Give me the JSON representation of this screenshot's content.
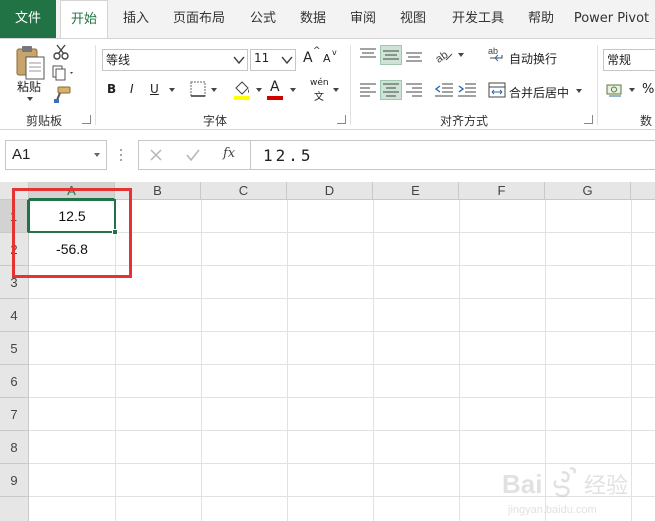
{
  "tabs": [
    {
      "id": "file",
      "label": "文件"
    },
    {
      "id": "home",
      "label": "开始"
    },
    {
      "id": "insert",
      "label": "插入"
    },
    {
      "id": "layout",
      "label": "页面布局"
    },
    {
      "id": "formula",
      "label": "公式"
    },
    {
      "id": "data",
      "label": "数据"
    },
    {
      "id": "review",
      "label": "审阅"
    },
    {
      "id": "view",
      "label": "视图"
    },
    {
      "id": "developer",
      "label": "开发工具"
    },
    {
      "id": "help",
      "label": "帮助"
    },
    {
      "id": "powerpivot",
      "label": "Power Pivot"
    }
  ],
  "ribbon": {
    "clipboard": {
      "paste_label": "粘贴",
      "group_label": "剪贴板"
    },
    "font": {
      "font_name": "等线",
      "font_size": "11",
      "group_label": "字体",
      "bold": "B",
      "italic": "I",
      "underline": "U",
      "grow": "A",
      "shrink": "A",
      "color_a": "A",
      "phonetic": "wén"
    },
    "alignment": {
      "wrap_label": "自动换行",
      "merge_label": "合并后居中",
      "group_label": "对齐方式"
    },
    "number": {
      "format": "常规",
      "percent": "%",
      "group_label": "数"
    }
  },
  "formula_bar": {
    "name_box": "A1",
    "fx": "fx",
    "content": "12.5"
  },
  "sheet": {
    "columns": [
      "A",
      "B",
      "C",
      "D",
      "E",
      "F",
      "G"
    ],
    "rows": [
      "1",
      "2",
      "3",
      "4",
      "5",
      "6",
      "7",
      "8",
      "9"
    ],
    "cells": {
      "A1": "12.5",
      "A2": "-56.8"
    }
  },
  "watermark": {
    "brand": "Bai",
    "brand2": "经验",
    "url": "jingyan.baidu.com"
  },
  "colors": {
    "accent": "#217346",
    "highlight": "#e53232",
    "font_color_bar": "#d40000",
    "fill_color_bar": "#ffff00"
  }
}
